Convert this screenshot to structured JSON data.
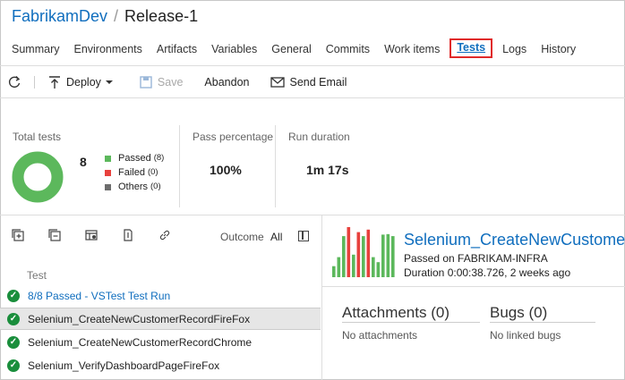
{
  "header": {
    "project": "FabrikamDev",
    "separator": "/",
    "release": "Release-1"
  },
  "tabs": [
    {
      "label": "Summary"
    },
    {
      "label": "Environments"
    },
    {
      "label": "Artifacts"
    },
    {
      "label": "Variables"
    },
    {
      "label": "General"
    },
    {
      "label": "Commits"
    },
    {
      "label": "Work items"
    },
    {
      "label": "Tests",
      "active": true
    },
    {
      "label": "Logs"
    },
    {
      "label": "History"
    }
  ],
  "toolbar": {
    "refresh_icon": "refresh-icon",
    "deploy_label": "Deploy",
    "save_label": "Save",
    "abandon_label": "Abandon",
    "email_label": "Send Email"
  },
  "summary": {
    "total_label": "Total tests",
    "total_value": "8",
    "legend": [
      {
        "label": "Passed",
        "count": "(8)",
        "color": "#5cb85c"
      },
      {
        "label": "Failed",
        "count": "(0)",
        "color": "#e8413d"
      },
      {
        "label": "Others",
        "count": "(0)",
        "color": "#6d6d6d"
      }
    ],
    "pass_label": "Pass percentage",
    "pass_value": "100%",
    "duration_label": "Run duration",
    "duration_value": "1m 17s",
    "donut_pass_fraction": 1.0
  },
  "left": {
    "outcome_label": "Outcome",
    "outcome_value": "All",
    "column_header": "Test",
    "rows": [
      {
        "label": "8/8 Passed - VSTest Test Run"
      },
      {
        "label": "Selenium_CreateNewCustomerRecordFireFox"
      },
      {
        "label": "Selenium_CreateNewCustomerRecordChrome"
      },
      {
        "label": "Selenium_VerifyDashboardPageFireFox"
      }
    ]
  },
  "right": {
    "title": "Selenium_CreateNewCustomerRecordFireFox",
    "status_line": "Passed on FABRIKAM-INFRA",
    "duration_line": "Duration 0:00:38.726, 2 weeks ago",
    "history_bars": [
      {
        "level": 0.22,
        "color": "#5cb85c"
      },
      {
        "level": 0.4,
        "color": "#5cb85c"
      },
      {
        "level": 0.82,
        "color": "#5cb85c"
      },
      {
        "level": 1.0,
        "color": "#e8413d"
      },
      {
        "level": 0.45,
        "color": "#5cb85c"
      },
      {
        "level": 0.9,
        "color": "#e8413d"
      },
      {
        "level": 0.82,
        "color": "#5cb85c"
      },
      {
        "level": 0.95,
        "color": "#e8413d"
      },
      {
        "level": 0.4,
        "color": "#5cb85c"
      },
      {
        "level": 0.3,
        "color": "#5cb85c"
      },
      {
        "level": 0.85,
        "color": "#5cb85c"
      },
      {
        "level": 0.86,
        "color": "#5cb85c"
      },
      {
        "level": 0.82,
        "color": "#5cb85c"
      }
    ],
    "attachments_title": "Attachments (0)",
    "attachments_empty": "No attachments",
    "bugs_title": "Bugs (0)",
    "bugs_empty": "No linked bugs"
  }
}
